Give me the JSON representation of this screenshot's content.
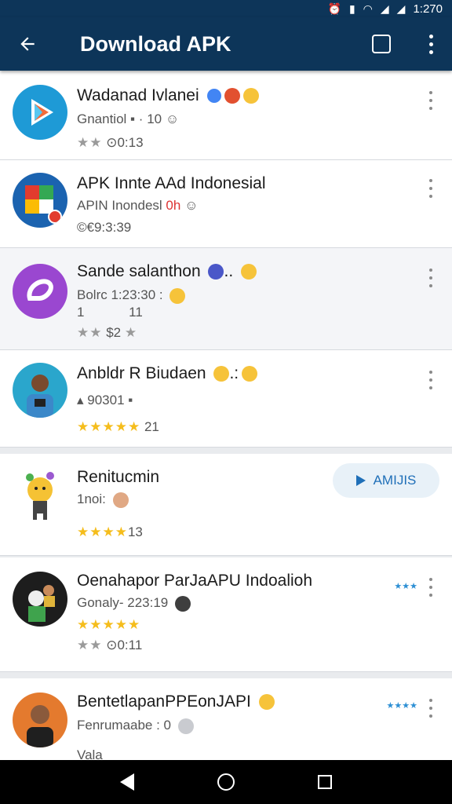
{
  "status": {
    "time": "1:270"
  },
  "app_bar": {
    "title": "Download APK",
    "icons": [
      "back-arrow-icon",
      "square-icon",
      "more-vert-icon"
    ]
  },
  "items": [
    {
      "name": "Wadanad Ivlanei",
      "sub": "Gnantiol",
      "sub_extra": "10",
      "meta": "0:13",
      "stars": "★★",
      "icon": "play-store-icon"
    },
    {
      "name": "APK Innte AAd Indonesial",
      "sub": "APIN Inondesl",
      "sub_extra": "0h",
      "meta": "©€9:3:39",
      "icon": "flag-app-icon"
    },
    {
      "name": "Sande salanthon",
      "sub": "Bolrc 1:23:30 :",
      "sub2": "1",
      "sub2b": "11",
      "meta": "$2",
      "stars": "★★",
      "icon": "purple-link-icon"
    },
    {
      "name": "Anbldr R Biudaen",
      "sub": "90301",
      "meta": "21",
      "stars": "★★★★★",
      "icon": "user-avatar-icon"
    },
    {
      "name": "Renitucmin",
      "sub": "1noi:",
      "meta": "13",
      "stars": "★★★★",
      "button": "AMIJIS",
      "icon": "mascot-icon"
    },
    {
      "name": "Oenahapor ParJaAPU Indoalioh",
      "sub": "Gonaly- 223:19",
      "meta": "0:11",
      "stars": "★★★★★",
      "stars2": "★★",
      "mini": "★★★",
      "icon": "group-photo-icon"
    },
    {
      "name": "BentetlapanPPEonJAPI",
      "sub": "Fenrumaabe : 0",
      "sub2": "Vala",
      "mini": "★★★★",
      "icon": "man-avatar-icon"
    }
  ],
  "colors": {
    "app_bar": "#0d3559",
    "accent": "#1f6fb8",
    "star": "#f5bd1c"
  }
}
